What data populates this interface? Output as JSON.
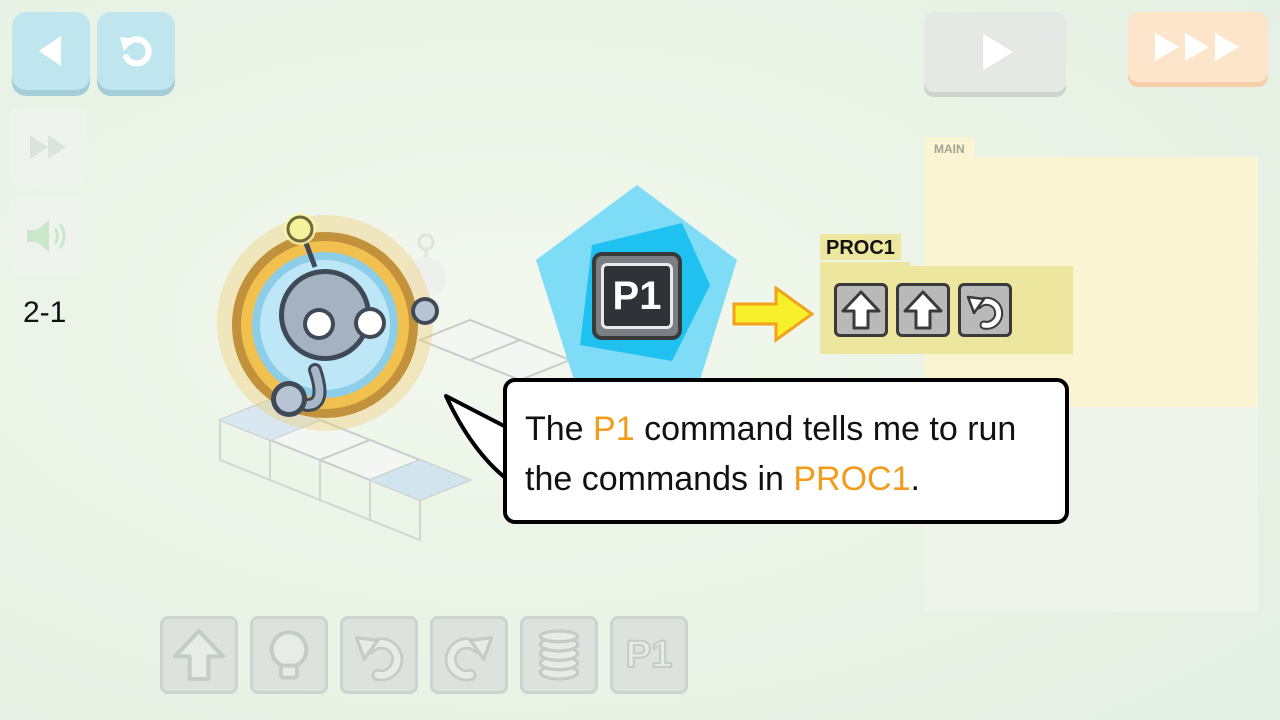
{
  "toolbar": {
    "back_icon": "back-arrow-icon",
    "reset_icon": "reset-icon",
    "play_icon": "play-icon",
    "fast_forward_icon": "fast-forward-triple-icon"
  },
  "side": {
    "speed_icon": "speed-icon",
    "sound_icon": "sound-icon",
    "level_label": "2-1"
  },
  "program": {
    "main_label": "MAIN"
  },
  "tutorial": {
    "command_icon_label": "P1",
    "proc_label": "PROC1",
    "proc_commands": [
      "forward-arrow-icon",
      "forward-arrow-icon",
      "turn-left-icon"
    ],
    "message": {
      "part1": "The ",
      "highlight1": "P1",
      "part2": " command tells me to run the commands in ",
      "highlight2": "PROC1",
      "part3": "."
    }
  },
  "toolbox": {
    "items": [
      {
        "icon": "forward-arrow-icon"
      },
      {
        "icon": "lightbulb-icon"
      },
      {
        "icon": "turn-left-icon"
      },
      {
        "icon": "turn-right-icon"
      },
      {
        "icon": "jump-spring-icon"
      },
      {
        "icon": "p1-icon",
        "label": "P1"
      }
    ]
  },
  "colors": {
    "highlight": "#f39c1c",
    "pentagon": "#7fdcf7",
    "proc_bg": "#ece69e",
    "main_bg": "#fbf4d2",
    "top_button_blue": "#bfe6ef",
    "fast_button_orange": "#fde5cc"
  }
}
